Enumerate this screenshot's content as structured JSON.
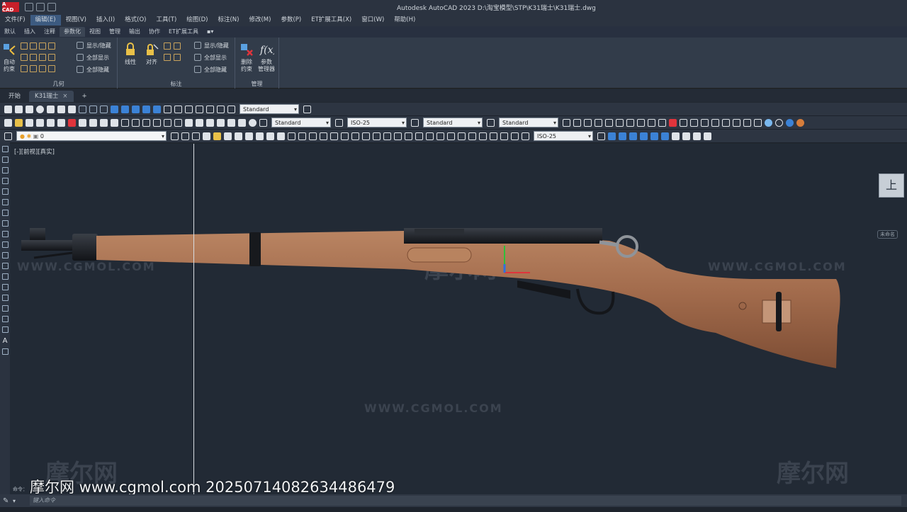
{
  "app": {
    "logo_text": "A CAD",
    "title": "Autodesk AutoCAD 2023    D:\\淘宝模型\\STP\\K31瑞士\\K31瑞士.dwg"
  },
  "menubar": {
    "items": [
      "文件(F)",
      "编辑(E)",
      "视图(V)",
      "插入(I)",
      "格式(O)",
      "工具(T)",
      "绘图(D)",
      "标注(N)",
      "修改(M)",
      "参数(P)",
      "ET扩展工具(X)",
      "窗口(W)",
      "帮助(H)"
    ],
    "active_index": 1
  },
  "ribbon_tabs": {
    "items": [
      "默认",
      "插入",
      "注释",
      "参数化",
      "视图",
      "管理",
      "输出",
      "协作",
      "ET扩展工具"
    ],
    "active_index": 3
  },
  "ribbon": {
    "geometry_panel": {
      "title": "几何",
      "auto_constrain": "自动\n约束",
      "show_hide": "显示/隐藏",
      "show_all": "全部显示",
      "hide_all": "全部隐藏"
    },
    "dimension_panel": {
      "title": "标注",
      "linear": "线性",
      "aligned": "对齐",
      "show_hide": "显示/隐藏",
      "show_all": "全部显示",
      "hide_all": "全部隐藏"
    },
    "manage_panel": {
      "title": "管理",
      "delete_constraint": "删除\n约束",
      "params_manager": "参数\n管理器"
    }
  },
  "file_tabs": {
    "start": "开始",
    "current": "K31瑞士",
    "close": "×",
    "add": "+"
  },
  "toolbars": {
    "visual_style": "Standard",
    "text_style": "Standard",
    "dim_style": "ISO-25",
    "table_style": "Standard",
    "multileader_style": "Standard",
    "layer": "0",
    "dim_style_right": "ISO-25"
  },
  "viewport": {
    "label": "[-][前视][真实]",
    "viewcube_face": "上",
    "wcs_label": "未命名"
  },
  "watermarks": {
    "url_text": "WWW.CGMOL.COM",
    "brand_cn": "摩尔网",
    "footer": "摩尔网 www.cgmol.com 20250714082634486479"
  },
  "command": {
    "history_label": "命令：",
    "placeholder": "键入命令"
  },
  "colors": {
    "stock": "#a0694a",
    "metal": "#1c1f24",
    "axis_x": "#e0343c",
    "axis_y": "#2fbf3a",
    "axis_z": "#2f6fe0"
  }
}
